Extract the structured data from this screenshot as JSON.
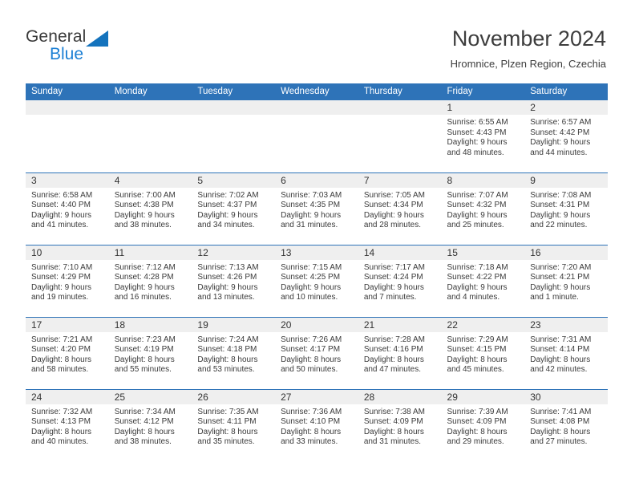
{
  "brand": {
    "name_part1": "General",
    "name_part2": "Blue",
    "triangle_icon": "blue-triangle-icon",
    "color_dark": "#3a3a3a",
    "color_blue": "#1b7fd4"
  },
  "header": {
    "title": "November 2024",
    "subtitle": "Hromnice, Plzen Region, Czechia"
  },
  "theme": {
    "header_blue": "#2E73B8",
    "daynum_band": "#efefef",
    "text": "#3a3a3a"
  },
  "calendar": {
    "weekday_headers": [
      "Sunday",
      "Monday",
      "Tuesday",
      "Wednesday",
      "Thursday",
      "Friday",
      "Saturday"
    ],
    "weeks": [
      [
        {
          "day": "",
          "sunrise": "",
          "sunset": "",
          "daylight_line1": "",
          "daylight_line2": ""
        },
        {
          "day": "",
          "sunrise": "",
          "sunset": "",
          "daylight_line1": "",
          "daylight_line2": ""
        },
        {
          "day": "",
          "sunrise": "",
          "sunset": "",
          "daylight_line1": "",
          "daylight_line2": ""
        },
        {
          "day": "",
          "sunrise": "",
          "sunset": "",
          "daylight_line1": "",
          "daylight_line2": ""
        },
        {
          "day": "",
          "sunrise": "",
          "sunset": "",
          "daylight_line1": "",
          "daylight_line2": ""
        },
        {
          "day": "1",
          "sunrise": "Sunrise: 6:55 AM",
          "sunset": "Sunset: 4:43 PM",
          "daylight_line1": "Daylight: 9 hours",
          "daylight_line2": "and 48 minutes."
        },
        {
          "day": "2",
          "sunrise": "Sunrise: 6:57 AM",
          "sunset": "Sunset: 4:42 PM",
          "daylight_line1": "Daylight: 9 hours",
          "daylight_line2": "and 44 minutes."
        }
      ],
      [
        {
          "day": "3",
          "sunrise": "Sunrise: 6:58 AM",
          "sunset": "Sunset: 4:40 PM",
          "daylight_line1": "Daylight: 9 hours",
          "daylight_line2": "and 41 minutes."
        },
        {
          "day": "4",
          "sunrise": "Sunrise: 7:00 AM",
          "sunset": "Sunset: 4:38 PM",
          "daylight_line1": "Daylight: 9 hours",
          "daylight_line2": "and 38 minutes."
        },
        {
          "day": "5",
          "sunrise": "Sunrise: 7:02 AM",
          "sunset": "Sunset: 4:37 PM",
          "daylight_line1": "Daylight: 9 hours",
          "daylight_line2": "and 34 minutes."
        },
        {
          "day": "6",
          "sunrise": "Sunrise: 7:03 AM",
          "sunset": "Sunset: 4:35 PM",
          "daylight_line1": "Daylight: 9 hours",
          "daylight_line2": "and 31 minutes."
        },
        {
          "day": "7",
          "sunrise": "Sunrise: 7:05 AM",
          "sunset": "Sunset: 4:34 PM",
          "daylight_line1": "Daylight: 9 hours",
          "daylight_line2": "and 28 minutes."
        },
        {
          "day": "8",
          "sunrise": "Sunrise: 7:07 AM",
          "sunset": "Sunset: 4:32 PM",
          "daylight_line1": "Daylight: 9 hours",
          "daylight_line2": "and 25 minutes."
        },
        {
          "day": "9",
          "sunrise": "Sunrise: 7:08 AM",
          "sunset": "Sunset: 4:31 PM",
          "daylight_line1": "Daylight: 9 hours",
          "daylight_line2": "and 22 minutes."
        }
      ],
      [
        {
          "day": "10",
          "sunrise": "Sunrise: 7:10 AM",
          "sunset": "Sunset: 4:29 PM",
          "daylight_line1": "Daylight: 9 hours",
          "daylight_line2": "and 19 minutes."
        },
        {
          "day": "11",
          "sunrise": "Sunrise: 7:12 AM",
          "sunset": "Sunset: 4:28 PM",
          "daylight_line1": "Daylight: 9 hours",
          "daylight_line2": "and 16 minutes."
        },
        {
          "day": "12",
          "sunrise": "Sunrise: 7:13 AM",
          "sunset": "Sunset: 4:26 PM",
          "daylight_line1": "Daylight: 9 hours",
          "daylight_line2": "and 13 minutes."
        },
        {
          "day": "13",
          "sunrise": "Sunrise: 7:15 AM",
          "sunset": "Sunset: 4:25 PM",
          "daylight_line1": "Daylight: 9 hours",
          "daylight_line2": "and 10 minutes."
        },
        {
          "day": "14",
          "sunrise": "Sunrise: 7:17 AM",
          "sunset": "Sunset: 4:24 PM",
          "daylight_line1": "Daylight: 9 hours",
          "daylight_line2": "and 7 minutes."
        },
        {
          "day": "15",
          "sunrise": "Sunrise: 7:18 AM",
          "sunset": "Sunset: 4:22 PM",
          "daylight_line1": "Daylight: 9 hours",
          "daylight_line2": "and 4 minutes."
        },
        {
          "day": "16",
          "sunrise": "Sunrise: 7:20 AM",
          "sunset": "Sunset: 4:21 PM",
          "daylight_line1": "Daylight: 9 hours",
          "daylight_line2": "and 1 minute."
        }
      ],
      [
        {
          "day": "17",
          "sunrise": "Sunrise: 7:21 AM",
          "sunset": "Sunset: 4:20 PM",
          "daylight_line1": "Daylight: 8 hours",
          "daylight_line2": "and 58 minutes."
        },
        {
          "day": "18",
          "sunrise": "Sunrise: 7:23 AM",
          "sunset": "Sunset: 4:19 PM",
          "daylight_line1": "Daylight: 8 hours",
          "daylight_line2": "and 55 minutes."
        },
        {
          "day": "19",
          "sunrise": "Sunrise: 7:24 AM",
          "sunset": "Sunset: 4:18 PM",
          "daylight_line1": "Daylight: 8 hours",
          "daylight_line2": "and 53 minutes."
        },
        {
          "day": "20",
          "sunrise": "Sunrise: 7:26 AM",
          "sunset": "Sunset: 4:17 PM",
          "daylight_line1": "Daylight: 8 hours",
          "daylight_line2": "and 50 minutes."
        },
        {
          "day": "21",
          "sunrise": "Sunrise: 7:28 AM",
          "sunset": "Sunset: 4:16 PM",
          "daylight_line1": "Daylight: 8 hours",
          "daylight_line2": "and 47 minutes."
        },
        {
          "day": "22",
          "sunrise": "Sunrise: 7:29 AM",
          "sunset": "Sunset: 4:15 PM",
          "daylight_line1": "Daylight: 8 hours",
          "daylight_line2": "and 45 minutes."
        },
        {
          "day": "23",
          "sunrise": "Sunrise: 7:31 AM",
          "sunset": "Sunset: 4:14 PM",
          "daylight_line1": "Daylight: 8 hours",
          "daylight_line2": "and 42 minutes."
        }
      ],
      [
        {
          "day": "24",
          "sunrise": "Sunrise: 7:32 AM",
          "sunset": "Sunset: 4:13 PM",
          "daylight_line1": "Daylight: 8 hours",
          "daylight_line2": "and 40 minutes."
        },
        {
          "day": "25",
          "sunrise": "Sunrise: 7:34 AM",
          "sunset": "Sunset: 4:12 PM",
          "daylight_line1": "Daylight: 8 hours",
          "daylight_line2": "and 38 minutes."
        },
        {
          "day": "26",
          "sunrise": "Sunrise: 7:35 AM",
          "sunset": "Sunset: 4:11 PM",
          "daylight_line1": "Daylight: 8 hours",
          "daylight_line2": "and 35 minutes."
        },
        {
          "day": "27",
          "sunrise": "Sunrise: 7:36 AM",
          "sunset": "Sunset: 4:10 PM",
          "daylight_line1": "Daylight: 8 hours",
          "daylight_line2": "and 33 minutes."
        },
        {
          "day": "28",
          "sunrise": "Sunrise: 7:38 AM",
          "sunset": "Sunset: 4:09 PM",
          "daylight_line1": "Daylight: 8 hours",
          "daylight_line2": "and 31 minutes."
        },
        {
          "day": "29",
          "sunrise": "Sunrise: 7:39 AM",
          "sunset": "Sunset: 4:09 PM",
          "daylight_line1": "Daylight: 8 hours",
          "daylight_line2": "and 29 minutes."
        },
        {
          "day": "30",
          "sunrise": "Sunrise: 7:41 AM",
          "sunset": "Sunset: 4:08 PM",
          "daylight_line1": "Daylight: 8 hours",
          "daylight_line2": "and 27 minutes."
        }
      ]
    ]
  }
}
